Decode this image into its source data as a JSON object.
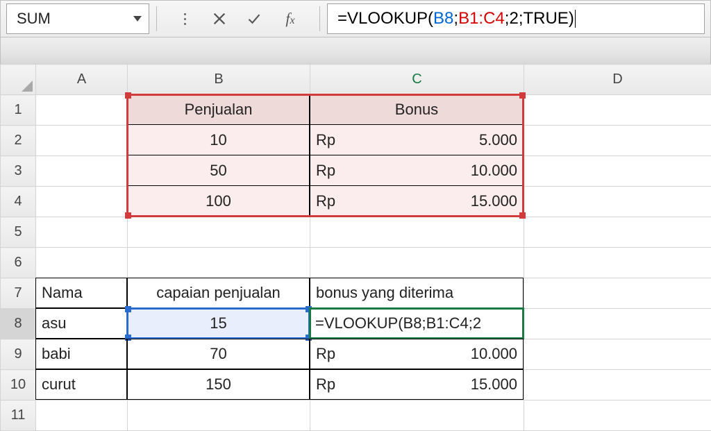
{
  "formula_bar": {
    "name_box": "SUM",
    "formula_prefix": "=VLOOKUP(",
    "arg1": "B8",
    "sep1": ";",
    "arg2": "B1:C4",
    "sep2": ";",
    "arg3": "2",
    "sep3": ";",
    "arg4": "TRUE",
    "close": ")"
  },
  "columns": {
    "A": "A",
    "B": "B",
    "C": "C",
    "D": "D"
  },
  "rows": [
    "1",
    "2",
    "3",
    "4",
    "5",
    "6",
    "7",
    "8",
    "9",
    "10",
    "11"
  ],
  "lookup_table": {
    "headers": {
      "b": "Penjualan",
      "c": "Bonus"
    },
    "rows": [
      {
        "b": "10",
        "c_label": "Rp",
        "c_value": "5.000"
      },
      {
        "b": "50",
        "c_label": "Rp",
        "c_value": "10.000"
      },
      {
        "b": "100",
        "c_label": "Rp",
        "c_value": "15.000"
      }
    ]
  },
  "data_table": {
    "headers": {
      "a": "Nama",
      "b": "capaian penjualan",
      "c": "bonus yang diterima"
    },
    "rows": [
      {
        "a": "asu",
        "b": "15",
        "c_formula": "=VLOOKUP(B8;B1:C4;2"
      },
      {
        "a": "babi",
        "b": "70",
        "c_label": "Rp",
        "c_value": "10.000"
      },
      {
        "a": "curut",
        "b": "150",
        "c_label": "Rp",
        "c_value": "15.000"
      }
    ]
  }
}
